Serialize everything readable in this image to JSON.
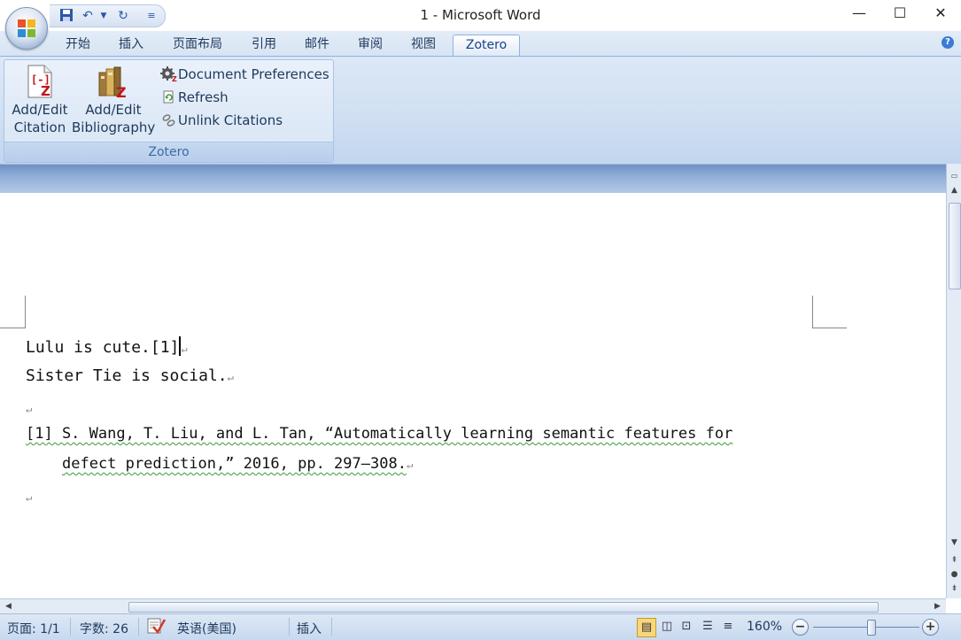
{
  "window": {
    "title": "1 - Microsoft Word",
    "minimize": "—",
    "maximize": "☐",
    "close": "✕"
  },
  "qat": {
    "save_icon": "save-icon",
    "undo_icon": "undo-icon",
    "redo_icon": "redo-icon",
    "customize_icon": "customize-icon"
  },
  "ribbon": {
    "tabs": [
      {
        "label": "开始"
      },
      {
        "label": "插入"
      },
      {
        "label": "页面布局"
      },
      {
        "label": "引用"
      },
      {
        "label": "邮件"
      },
      {
        "label": "审阅"
      },
      {
        "label": "视图"
      },
      {
        "label": "Zotero",
        "active": true
      }
    ],
    "help": "?",
    "group": {
      "label": "Zotero",
      "add_citation": {
        "line1": "Add/Edit",
        "line2": "Citation"
      },
      "add_bibliography": {
        "line1": "Add/Edit",
        "line2": "Bibliography"
      },
      "document_preferences": "Document Preferences",
      "refresh": "Refresh",
      "unlink_citations": "Unlink Citations"
    }
  },
  "document": {
    "line1": "Lulu is cute.[1]",
    "line2": "Sister Tie is social.",
    "reference_line1": "[1] S. Wang, T. Liu, and L. Tan, “Automatically learning semantic features for",
    "reference_line2": "defect prediction,” 2016, pp. 297–308.",
    "paragraph_mark": "↵"
  },
  "statusbar": {
    "page": "页面: 1/1",
    "words": "字数: 26",
    "language": "英语(美国)",
    "mode": "插入",
    "zoom": "160%",
    "zoom_out": "−",
    "zoom_in": "+",
    "zoom_level": 0.55
  },
  "colors": {
    "accent": "#15428b",
    "ribbon": "#dce8f6",
    "squiggle": "#3a9a3a"
  }
}
